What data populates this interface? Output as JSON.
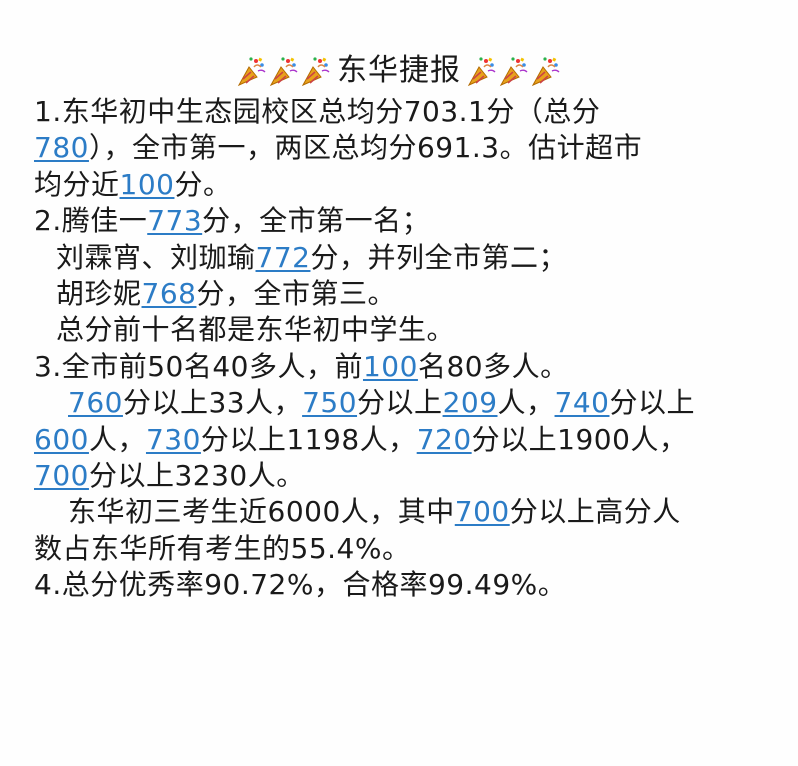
{
  "title": "东华捷报",
  "title_icon": "party-popper-icon",
  "link_color": "#2c7cc6",
  "lines": [
    {
      "indent": 0,
      "segments": [
        {
          "text": "1.东华初中生态园校区总均分703.1分（总分"
        }
      ]
    },
    {
      "indent": 0,
      "segments": [
        {
          "text": "780",
          "link": true
        },
        {
          "text": "），全市第一，两区总均分691.3。估计超市"
        }
      ]
    },
    {
      "indent": 0,
      "segments": [
        {
          "text": "均分近"
        },
        {
          "text": "100",
          "link": true
        },
        {
          "text": "分。"
        }
      ]
    },
    {
      "indent": 0,
      "segments": [
        {
          "text": "2.腾佳一"
        },
        {
          "text": "773",
          "link": true
        },
        {
          "text": "分，全市第一名；"
        }
      ]
    },
    {
      "indent": 1,
      "segments": [
        {
          "text": "刘霖宵、刘珈瑜"
        },
        {
          "text": "772",
          "link": true
        },
        {
          "text": "分，并列全市第二；"
        }
      ]
    },
    {
      "indent": 1,
      "segments": [
        {
          "text": "胡珍妮"
        },
        {
          "text": "768",
          "link": true
        },
        {
          "text": "分，全市第三。"
        }
      ]
    },
    {
      "indent": 1,
      "segments": [
        {
          "text": "总分前十名都是东华初中学生。"
        }
      ]
    },
    {
      "indent": 0,
      "segments": [
        {
          "text": "3.全市前50名40多人，前"
        },
        {
          "text": "100",
          "link": true
        },
        {
          "text": "名80多人。"
        }
      ]
    },
    {
      "indent": 2,
      "segments": [
        {
          "text": "760",
          "link": true
        },
        {
          "text": "分以上33人，"
        },
        {
          "text": "750",
          "link": true
        },
        {
          "text": "分以上"
        },
        {
          "text": "209",
          "link": true
        },
        {
          "text": "人，"
        },
        {
          "text": "740",
          "link": true
        },
        {
          "text": "分以上"
        }
      ]
    },
    {
      "indent": 0,
      "segments": [
        {
          "text": "600",
          "link": true
        },
        {
          "text": "人，"
        },
        {
          "text": "730",
          "link": true
        },
        {
          "text": "分以上1198人，"
        },
        {
          "text": "720",
          "link": true
        },
        {
          "text": "分以上1900人，"
        }
      ]
    },
    {
      "indent": 0,
      "segments": [
        {
          "text": "700",
          "link": true
        },
        {
          "text": "分以上3230人。"
        }
      ]
    },
    {
      "indent": 2,
      "segments": [
        {
          "text": "东华初三考生近6000人，其中"
        },
        {
          "text": "700",
          "link": true
        },
        {
          "text": "分以上高分人"
        }
      ]
    },
    {
      "indent": 0,
      "segments": [
        {
          "text": "数占东华所有考生的55.4%。"
        }
      ]
    },
    {
      "indent": 0,
      "segments": [
        {
          "text": "4.总分优秀率90.72%，合格率99.49%。"
        }
      ]
    }
  ]
}
